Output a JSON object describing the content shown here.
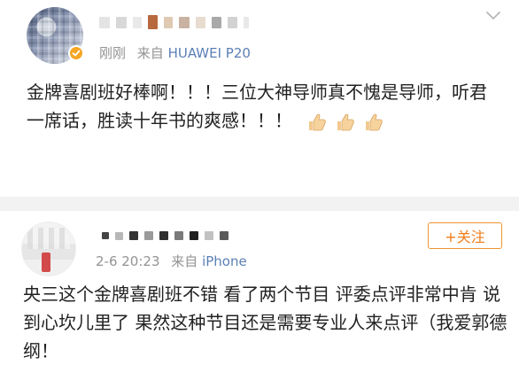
{
  "post1": {
    "author_name_hidden": true,
    "time": "刚刚",
    "source_prefix": "来自",
    "source_device": "HUAWEI P20",
    "text": "金牌喜剧班好棒啊！！！三位大神导师真不愧是导师，听君一席话，胜读十年书的爽感！！！",
    "emoji": [
      "thumbs-up",
      "thumbs-up",
      "thumbs-up"
    ],
    "verified_color": "#f5a623"
  },
  "post2": {
    "author_name_hidden": true,
    "time": "2-6 20:23",
    "source_prefix": "来自",
    "source_device": "iPhone",
    "follow_label": "+关注",
    "text": "央三这个金牌喜剧班不错 看了两个节目 评委点评非常中肯 说到心坎儿里了 果然这种节目还是需要专业人来点评（我爱郭德纲！"
  },
  "colors": {
    "link": "#5b7fb5",
    "meta": "#939393",
    "follow": "#f07d1a",
    "separator": "#f2f2f2"
  }
}
